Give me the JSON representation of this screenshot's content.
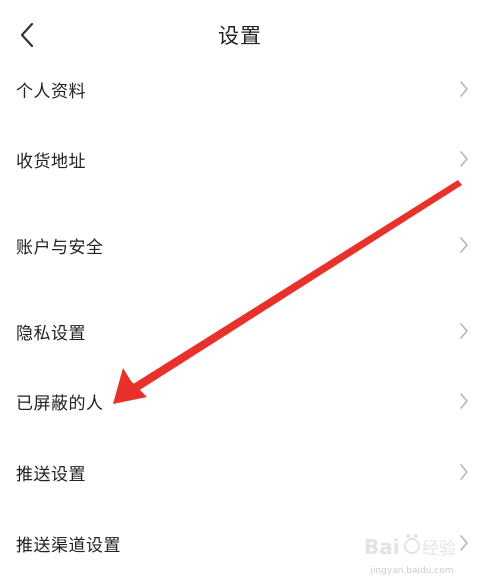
{
  "header": {
    "title": "设置",
    "back_icon": "chevron-left-icon"
  },
  "menu": {
    "items": [
      {
        "label": "个人资料",
        "icon": "chevron-right-icon"
      },
      {
        "label": "收货地址",
        "icon": "chevron-right-icon"
      },
      {
        "label": "账户与安全",
        "icon": "chevron-right-icon"
      },
      {
        "label": "隐私设置",
        "icon": "chevron-right-icon"
      },
      {
        "label": "已屏蔽的人",
        "icon": "chevron-right-icon"
      },
      {
        "label": "推送设置",
        "icon": "chevron-right-icon"
      },
      {
        "label": "推送渠道设置",
        "icon": "chevron-right-icon"
      }
    ]
  },
  "annotation": {
    "type": "red-arrow",
    "color": "#e8312a",
    "points_to": "已屏蔽的人"
  },
  "watermark": {
    "text": "Baidu经验",
    "sub": "jingyan.baidu.com"
  },
  "colors": {
    "text": "#222222",
    "chevron": "#b5b5b5",
    "arrow": "#e8312a"
  }
}
